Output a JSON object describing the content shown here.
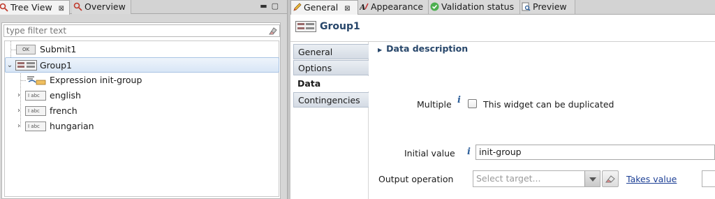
{
  "left_tabs": {
    "tree_view": "Tree View",
    "overview": "Overview"
  },
  "filter": {
    "placeholder": "type filter text"
  },
  "tree": {
    "items": [
      {
        "label": "Submit1",
        "badge": "OK"
      },
      {
        "label": "Group1"
      },
      {
        "label": "Expression init-group"
      },
      {
        "label": "english",
        "badge": "abc"
      },
      {
        "label": "french",
        "badge": "abc"
      },
      {
        "label": "hungarian",
        "badge": "abc"
      }
    ]
  },
  "right_tabs": {
    "general": "General",
    "appearance": "Appearance",
    "validation": "Validation status",
    "preview": "Preview"
  },
  "header": {
    "title": "Group1"
  },
  "side_tabs": [
    "General",
    "Options",
    "Data",
    "Contingencies"
  ],
  "form": {
    "section_title": "Data description",
    "multiple_label": "Multiple",
    "multiple_checkbox_label": "This widget can be duplicated",
    "initial_value_label": "Initial value",
    "initial_value": "init-group",
    "output_operation_label": "Output operation",
    "select_target_placeholder": "Select target...",
    "takes_value_link": "Takes value"
  },
  "colors": {
    "accent_title": "#27466a",
    "link": "#1c3f95",
    "info_icon": "#2d5f9a"
  }
}
